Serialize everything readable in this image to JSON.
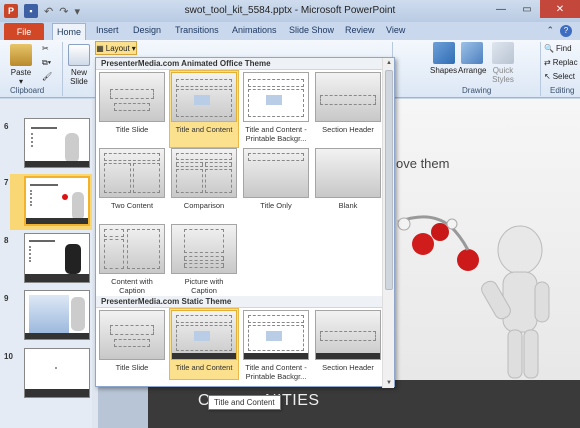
{
  "window": {
    "title": "swot_tool_kit_5584.pptx - Microsoft PowerPoint"
  },
  "tabs": [
    "File",
    "Home",
    "Insert",
    "Design",
    "Transitions",
    "Animations",
    "Slide Show",
    "Review",
    "View"
  ],
  "ribbon": {
    "paste": "Paste",
    "new_slide": "New Slide",
    "layout": "Layout",
    "clipboard_label": "Clipboard",
    "drawing_label": "Drawing",
    "editing_label": "Editing",
    "shapes": "Shapes",
    "arrange": "Arrange",
    "quick_styles": "Quick Styles",
    "find": "Find",
    "replace": "Replac",
    "select": "Select"
  },
  "gallery": {
    "header1": "PresenterMedia.com Animated Office Theme",
    "header2": "PresenterMedia.com Static Theme",
    "animated_layouts": [
      "Title Slide",
      "Title and Content",
      "Title and Content - Printable Backgr...",
      "Section Header",
      "Two Content",
      "Comparison",
      "Title Only",
      "Blank",
      "Content with Caption",
      "Picture with Caption"
    ],
    "static_layouts": [
      "Title Slide",
      "Title and Content",
      "Title and Content - Printable Backgr...",
      "Section Header"
    ]
  },
  "thumbnails": [
    "6",
    "7",
    "8",
    "9",
    "10"
  ],
  "slide": {
    "text_right": "ove them",
    "bottom_text": "O",
    "bottom_text2": "NITIES"
  },
  "tooltip": "Title and Content",
  "colors": {
    "file_tab": "#d24726",
    "selection": "#fbe08d",
    "accent": "#f2b22c"
  },
  "icons": [
    "powerpoint-icon",
    "save-icon",
    "undo-icon",
    "redo-icon",
    "help-icon",
    "paste-icon",
    "shapes-icon",
    "arrange-icon",
    "quick-styles-icon",
    "find-icon"
  ]
}
